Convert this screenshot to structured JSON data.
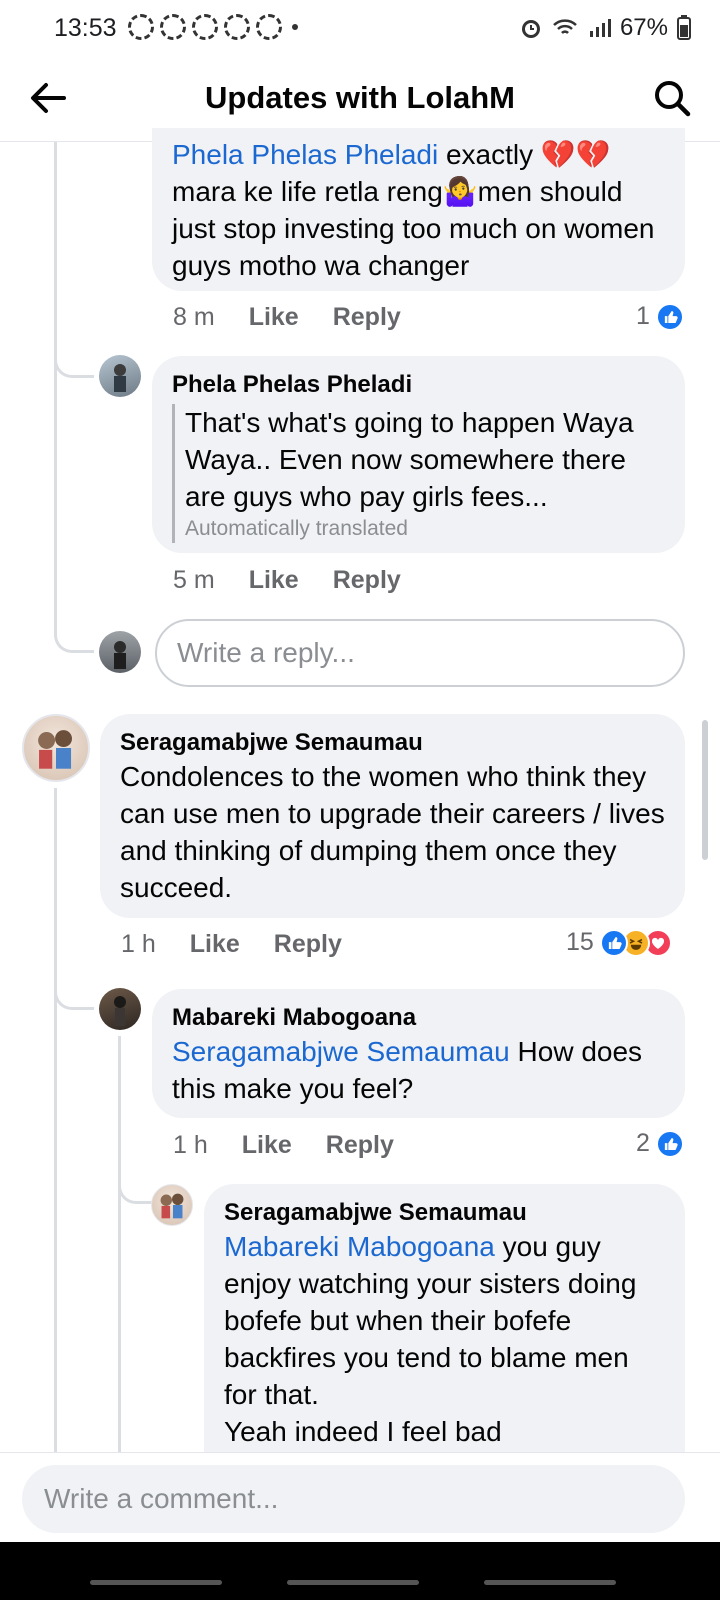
{
  "status": {
    "time": "13:53",
    "battery": "67%"
  },
  "header": {
    "title": "Updates with LolahM"
  },
  "comments": [
    {
      "mention": "Phela Phelas Pheladi",
      "text_line1_rest": " exactly 💔💔",
      "text_rest": "mara ke life retla reng🤷‍♀️men should just stop investing too much on women guys motho wa changer",
      "time": "8 m",
      "like": "Like",
      "reply": "Reply",
      "reaction_count": "1"
    },
    {
      "author": "Phela Phelas Pheladi",
      "text": "That's what's going to happen Waya Waya.. Even now somewhere there are guys who pay girls fees...",
      "translated": "Automatically translated",
      "time": "5 m",
      "like": "Like",
      "reply": "Reply"
    },
    {
      "author": "Seragamabjwe Semaumau",
      "text": "Condolences to the women who think they can use men to upgrade their careers / lives and thinking of dumping them once they succeed.",
      "time": "1 h",
      "like": "Like",
      "reply": "Reply",
      "reaction_count": "15"
    },
    {
      "author": "Mabareki Mabogoana",
      "mention": "Seragamabjwe Semaumau",
      "text": " How does this make you feel?",
      "time": "1 h",
      "like": "Like",
      "reply": "Reply",
      "reaction_count": "2"
    },
    {
      "author": "Seragamabjwe Semaumau",
      "mention": "Mabareki Mabogoana",
      "text": " you guy enjoy watching your sisters doing bofefe but when their bofefe backfires you tend to blame men for that.",
      "text2": "Yeah indeed I feel bad"
    }
  ],
  "reply_input": {
    "placeholder": "Write a reply..."
  },
  "comment_input": {
    "placeholder": "Write a comment..."
  },
  "colors": {
    "mention": "#1b68d1",
    "bubble": "#f0f2f5",
    "like_blue": "#1877f2"
  }
}
